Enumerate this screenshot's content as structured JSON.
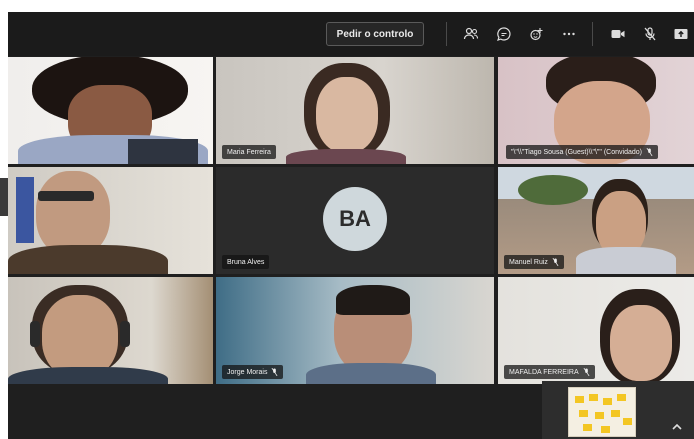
{
  "toolbar": {
    "raise_hand_label": "Pedir o controlo",
    "icons": [
      "people-icon",
      "chat-icon",
      "reactions-icon",
      "more-icon",
      "camera-icon",
      "mic-off-icon",
      "share-icon"
    ]
  },
  "participants": [
    {
      "name": "",
      "muted": false
    },
    {
      "name": "Maria Ferreira",
      "muted": false
    },
    {
      "name": "\"\\\"\\\\\"Tiago Sousa (Guest)\\\\\"\\\"\" (Convidado)",
      "muted": true
    },
    {
      "name": "",
      "muted": false
    },
    {
      "name": "Bruna Alves",
      "muted": false,
      "initials": "BA"
    },
    {
      "name": "Manuel Ruiz",
      "muted": true
    },
    {
      "name": "",
      "muted": false
    },
    {
      "name": "Jorge Morais",
      "muted": true
    },
    {
      "name": "MAFALDA FERREIRA",
      "muted": true
    }
  ],
  "colors": {
    "stage": "#1f1f1f",
    "toolbar": "#1b1b1b",
    "avatar_bg": "#cfd8dc",
    "sticky_note": "#f3c623"
  }
}
